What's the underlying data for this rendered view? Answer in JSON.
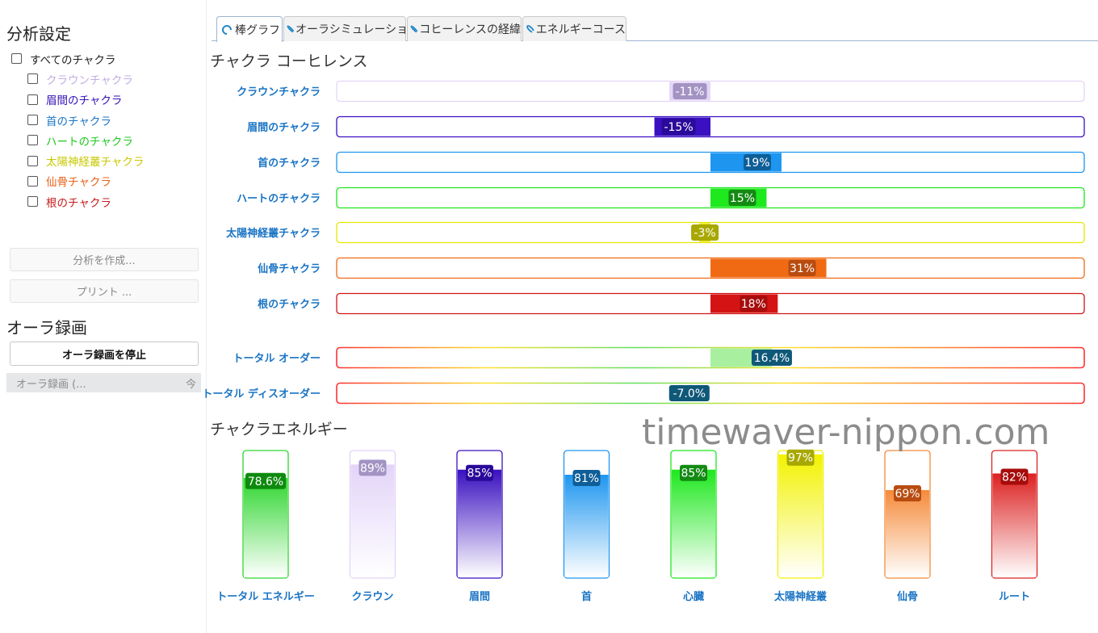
{
  "sidebar": {
    "analysis_title": "分析設定",
    "checkboxes": [
      {
        "label": "すべてのチャクラ",
        "color": "#222222",
        "indent": false,
        "checked": false
      },
      {
        "label": "クラウンチャクラ",
        "color": "#c0aee0",
        "indent": true,
        "checked": false
      },
      {
        "label": "眉間のチャクラ",
        "color": "#3411b8",
        "indent": true,
        "checked": false
      },
      {
        "label": "首のチャクラ",
        "color": "#1a74c4",
        "indent": true,
        "checked": false
      },
      {
        "label": "ハートのチャクラ",
        "color": "#1ec81e",
        "indent": true,
        "checked": false
      },
      {
        "label": "太陽神経叢チャクラ",
        "color": "#c8c800",
        "indent": true,
        "checked": false
      },
      {
        "label": "仙骨チャクラ",
        "color": "#e8601a",
        "indent": true,
        "checked": false
      },
      {
        "label": "根のチャクラ",
        "color": "#c81a1a",
        "indent": true,
        "checked": false
      }
    ],
    "create_analysis_label": "分析を作成...",
    "print_label": "プリント ...",
    "aura_title": "オーラ録画",
    "stop_recording_label": "オーラ録画を停止",
    "recording_field_text": "オーラ録画 (...",
    "recording_field_suffix": "今"
  },
  "tabs": [
    {
      "label": "棒グラフ",
      "active": true
    },
    {
      "label": "オーラシミュレーション",
      "active": false
    },
    {
      "label": "コヒーレンスの経緯",
      "active": false
    },
    {
      "label": "エネルギーコース",
      "active": false
    }
  ],
  "coherence_title": "チャクラ  コーヒレンス",
  "energy_title": "チャクラエネルギー",
  "watermark": "timewaver-nippon.com",
  "chart_data": [
    {
      "type": "bar",
      "orientation": "horizontal",
      "title": "チャクラ  コーヒレンス",
      "xlim": [
        -100,
        100
      ],
      "categories": [
        "クラウンチャクラ",
        "眉間のチャクラ",
        "首のチャクラ",
        "ハートのチャクラ",
        "太陽神経叢チャクラ",
        "仙骨チャクラ",
        "根のチャクラ"
      ],
      "values": [
        -11,
        -15,
        19,
        15,
        -3,
        31,
        18
      ],
      "value_labels": [
        "-11%",
        "-15%",
        "19%",
        "15%",
        "-3%",
        "31%",
        "18%"
      ],
      "colors": [
        "#e3d6f7",
        "#3a10c0",
        "#1e96f0",
        "#1ee81e",
        "#e6e600",
        "#f06a14",
        "#d41414"
      ],
      "badge_colors": [
        "#a293c3",
        "#2a0a9a",
        "#0e5e98",
        "#138a13",
        "#a8a800",
        "#b84c10",
        "#a80c0c"
      ],
      "label_color": "#1a74c4",
      "totals": {
        "categories": [
          "トータル オーダー",
          "トータル ディスオーダー"
        ],
        "values": [
          16.4,
          -7.0
        ],
        "value_labels": [
          "16.4%",
          "-7.0%"
        ]
      }
    },
    {
      "type": "bar",
      "orientation": "vertical",
      "title": "チャクラエネルギー",
      "ylim": [
        0,
        100
      ],
      "categories": [
        "トータル エネルギー",
        "クラウン",
        "眉間",
        "首",
        "心臓",
        "太陽神経叢",
        "仙骨",
        "ルート"
      ],
      "values": [
        78.6,
        89,
        85,
        81,
        85,
        97,
        69,
        82
      ],
      "value_labels": [
        "78.6%",
        "89%",
        "85%",
        "81%",
        "85%",
        "97%",
        "69%",
        "82%"
      ],
      "colors": [
        "#2ed62e",
        "#e2d4f8",
        "#3a10c0",
        "#1e96f0",
        "#1ee81e",
        "#f2f200",
        "#f58a3a",
        "#dc2020"
      ],
      "badge_colors": [
        "#0e8a0e",
        "#a293c3",
        "#2a0a9a",
        "#0e5e98",
        "#138a13",
        "#a8a800",
        "#b84c10",
        "#a80c0c"
      ],
      "label_color": "#1a74c4"
    }
  ]
}
